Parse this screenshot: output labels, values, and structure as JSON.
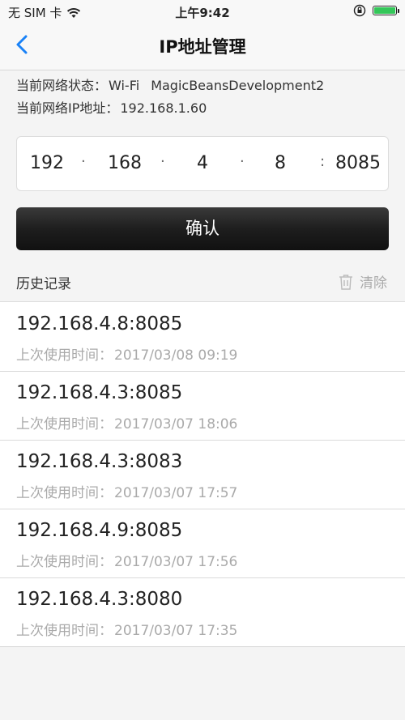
{
  "status_bar": {
    "carrier": "无 SIM 卡",
    "time": "上午9:42",
    "battery_level": 1.0,
    "icons": [
      "wifi-icon",
      "orientation-lock-icon",
      "battery-icon"
    ]
  },
  "nav": {
    "title": "IP地址管理",
    "back_icon": "chevron-left-icon"
  },
  "network_info": {
    "status_label": "当前网络状态：",
    "status_value": "Wi-Fi",
    "ssid": "MagicBeansDevelopment2",
    "ip_label": "当前网络IP地址：",
    "ip_value": "192.168.1.60"
  },
  "ip_input": {
    "octets": [
      "192",
      "168",
      "4",
      "8"
    ],
    "separator": "·",
    "port_separator": ":",
    "port": "8085"
  },
  "confirm_label": "确认",
  "history": {
    "title": "历史记录",
    "clear_label": "清除",
    "clear_icon": "trash-icon",
    "time_label": "上次使用时间：",
    "items": [
      {
        "address": "192.168.4.8:8085",
        "time": "2017/03/08 09:19"
      },
      {
        "address": "192.168.4.3:8085",
        "time": "2017/03/07 18:06"
      },
      {
        "address": "192.168.4.3:8083",
        "time": "2017/03/07 17:57"
      },
      {
        "address": "192.168.4.9:8085",
        "time": "2017/03/07 17:56"
      },
      {
        "address": "192.168.4.3:8080",
        "time": "2017/03/07 17:35"
      }
    ]
  },
  "colors": {
    "accent": "#1a82f7",
    "battery": "#34c759",
    "button_dark": "#1e1e1e",
    "muted_text": "#aaaaaa"
  }
}
